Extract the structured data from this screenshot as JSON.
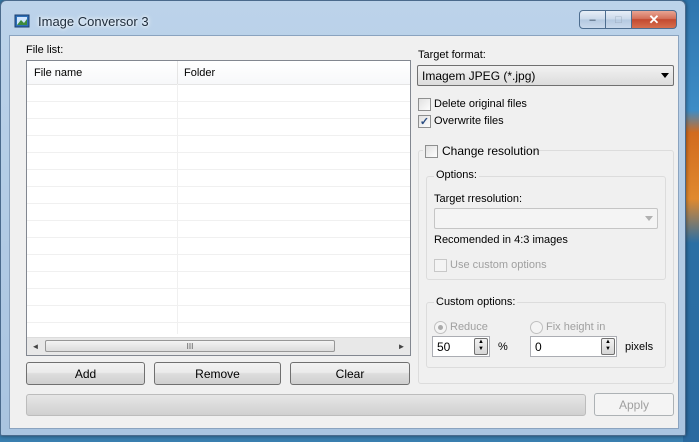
{
  "window": {
    "title": "Image Conversor 3",
    "minimize": "–",
    "maximize": "□",
    "close": "✕"
  },
  "file_list": {
    "label": "File list:",
    "columns": [
      "File name",
      "Folder"
    ]
  },
  "buttons": {
    "add": "Add",
    "remove": "Remove",
    "clear": "Clear",
    "apply": "Apply"
  },
  "target_format": {
    "label": "Target format:",
    "value": "Imagem JPEG (*.jpg)"
  },
  "checkboxes": {
    "delete_original": {
      "label": "Delete original files",
      "checked": false
    },
    "overwrite": {
      "label": "Overwrite files",
      "checked": true
    },
    "change_resolution": {
      "label": "Change resolution",
      "checked": false
    }
  },
  "options": {
    "title": "Options:",
    "target_resolution_label": "Target rresolution:",
    "target_resolution_value": "",
    "recommended": "Recomended in 4:3 images",
    "use_custom": "Use custom options"
  },
  "custom_options": {
    "title": "Custom options:",
    "reduce_label": "Reduce",
    "fix_height_label": "Fix height in",
    "reduce_value": "50",
    "percent": "%",
    "height_value": "0",
    "pixels": "pixels"
  },
  "scrollbar": {
    "left": "◄",
    "right": "►",
    "grip": "III"
  },
  "colors": {
    "frame": "#bcd3ea",
    "close": "#c34a30",
    "client": "#f0f0f0"
  }
}
